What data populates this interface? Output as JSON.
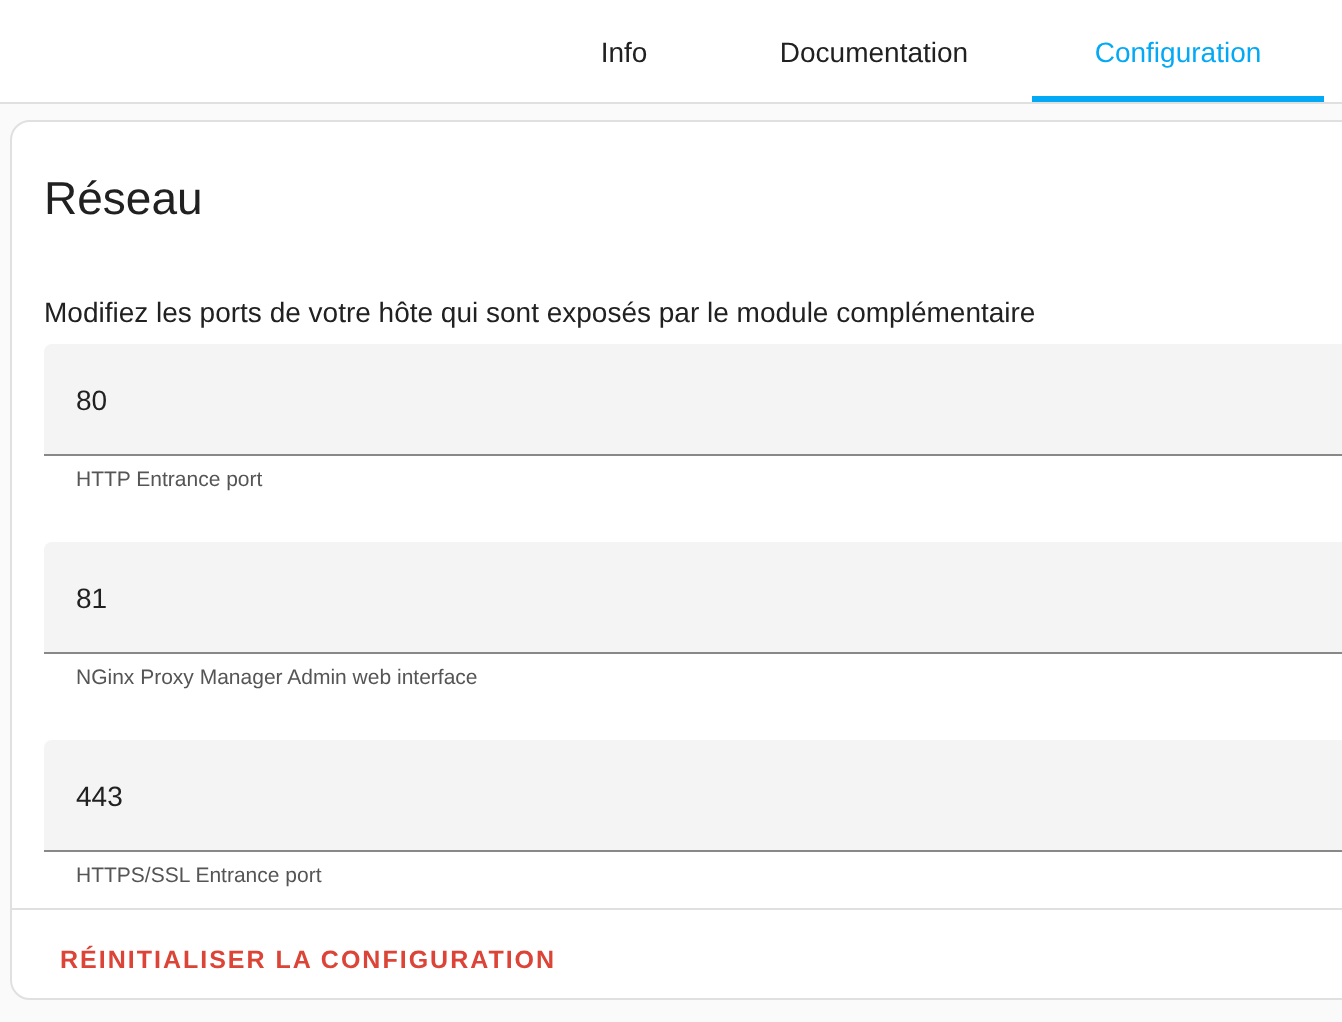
{
  "tabs": [
    {
      "label": "Info",
      "selected": false
    },
    {
      "label": "Documentation",
      "selected": false
    },
    {
      "label": "Configuration",
      "selected": true
    }
  ],
  "card": {
    "title": "Réseau",
    "description": "Modifiez les ports de votre hôte qui sont exposés par le module complémentaire",
    "fields": [
      {
        "value": "80",
        "helper": "HTTP Entrance port"
      },
      {
        "value": "81",
        "helper": "NGinx Proxy Manager Admin web interface"
      },
      {
        "value": "443",
        "helper": "HTTPS/SSL Entrance port"
      }
    ],
    "reset_button": "RÉINITIALISER LA CONFIGURATION"
  }
}
